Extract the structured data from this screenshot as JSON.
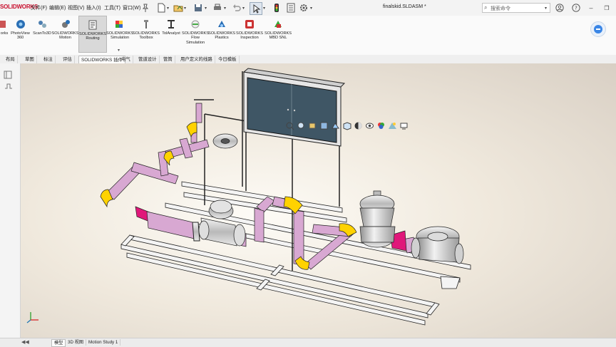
{
  "app": {
    "logo_text": "SOLIDWORKS"
  },
  "menu": [
    {
      "label": "文件(F)"
    },
    {
      "label": "编辑(E)"
    },
    {
      "label": "视图(V)"
    },
    {
      "label": "插入(I)"
    },
    {
      "label": "工具(T)"
    },
    {
      "label": "窗口(W)"
    }
  ],
  "document": {
    "title": "finalskid.SLDASM *"
  },
  "search": {
    "placeholder": "搜索命令"
  },
  "ribbon": [
    {
      "label": "orks"
    },
    {
      "label": "PhotoView 360"
    },
    {
      "label": "ScanTo3D"
    },
    {
      "label": "SOLIDWORKS Motion"
    },
    {
      "label": "SOLIDWORKS Routing"
    },
    {
      "label": "SOLIDWORKS Simulation"
    },
    {
      "label": "SOLIDWORKS Toolbox"
    },
    {
      "label": "TolAnalyst"
    },
    {
      "label": "SOLIDWORKS Flow Simulation"
    },
    {
      "label": "SOLIDWORKS Plastics"
    },
    {
      "label": "SOLIDWORKS Inspection"
    },
    {
      "label": "SOLIDWORKS MBD SNL"
    }
  ],
  "tabs": [
    {
      "label": "布局"
    },
    {
      "label": "草图"
    },
    {
      "label": "标注"
    },
    {
      "label": "评估"
    },
    {
      "label": "SOLIDWORKS 插件"
    },
    {
      "label": "电气"
    },
    {
      "label": "管道设计"
    },
    {
      "label": "管筒"
    },
    {
      "label": "用户定义的线路"
    },
    {
      "label": "今日模板"
    }
  ],
  "bottom_tabs": [
    {
      "label": "模型"
    },
    {
      "label": "3D 视图"
    },
    {
      "label": "Motion Study 1"
    }
  ],
  "colors": {
    "pipe_pink": "#d8a8d2",
    "elbow_yellow": "#ffd200",
    "reducer_magenta": "#e0177a",
    "steel": "#c9c9c9",
    "cabinet": "#3f5665"
  }
}
